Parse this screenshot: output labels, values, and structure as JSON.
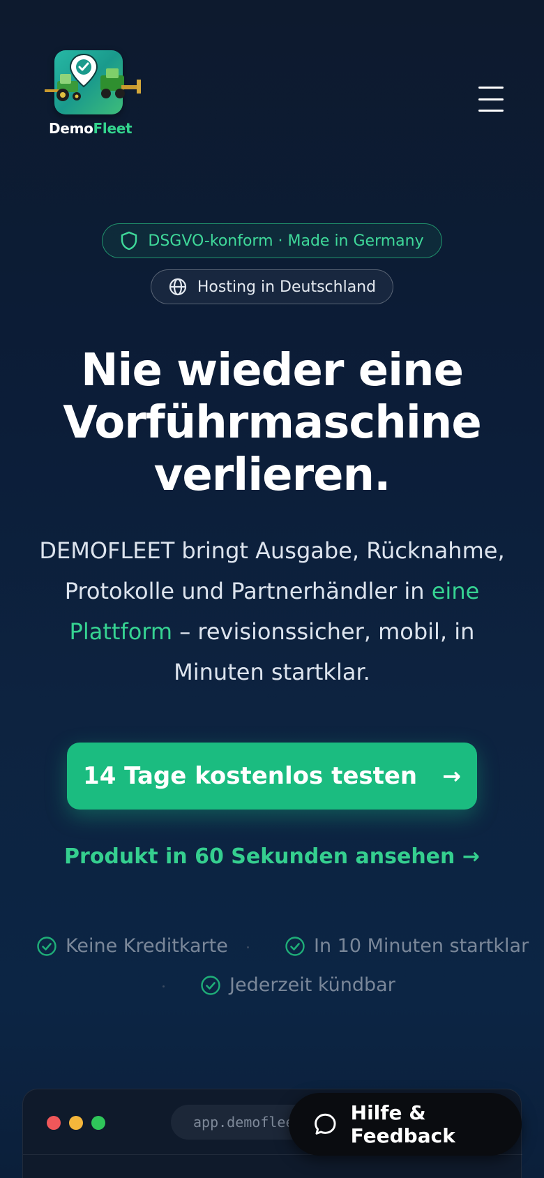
{
  "header": {
    "logo": {
      "word_white": "Demo",
      "word_green": "Fleet"
    },
    "menu_icon": "hamburger-menu-icon"
  },
  "badges": {
    "compliance": {
      "label": "DSGVO-konform · Made in Germany",
      "icon": "shield-icon"
    },
    "hosting": {
      "label": "Hosting in Deutschland",
      "icon": "globe-icon"
    }
  },
  "hero": {
    "title_line1": "Nie wieder eine",
    "title_line2": "Vorführmaschine",
    "title_line3": "verlieren.",
    "subtitle_before": "DEMOFLEET bringt Ausgabe, Rücknahme, Protokolle und Partnerhändler in ",
    "subtitle_accent": "eine Plattform",
    "subtitle_after": " – revisionssicher, mobil, in Minuten startklar."
  },
  "cta": {
    "primary_label": "14 Tage kostenlos testen",
    "primary_arrow": "→",
    "video_label": "Produkt in 60 Sekunden ansehen →"
  },
  "trust": [
    {
      "label": "Keine Kreditkarte",
      "icon": "check-circle-icon"
    },
    {
      "label": "In 10 Minuten startklar",
      "icon": "check-circle-icon"
    },
    {
      "label": "Jederzeit kündbar",
      "icon": "check-circle-icon"
    }
  ],
  "preview": {
    "url": "app.demofleet.de"
  },
  "help": {
    "label": "Hilfe & Feedback",
    "icon": "chat-bubble-icon"
  },
  "colors": {
    "accent": "#1bbc80",
    "accent_text": "#36d392",
    "background": "#0c1d38"
  }
}
